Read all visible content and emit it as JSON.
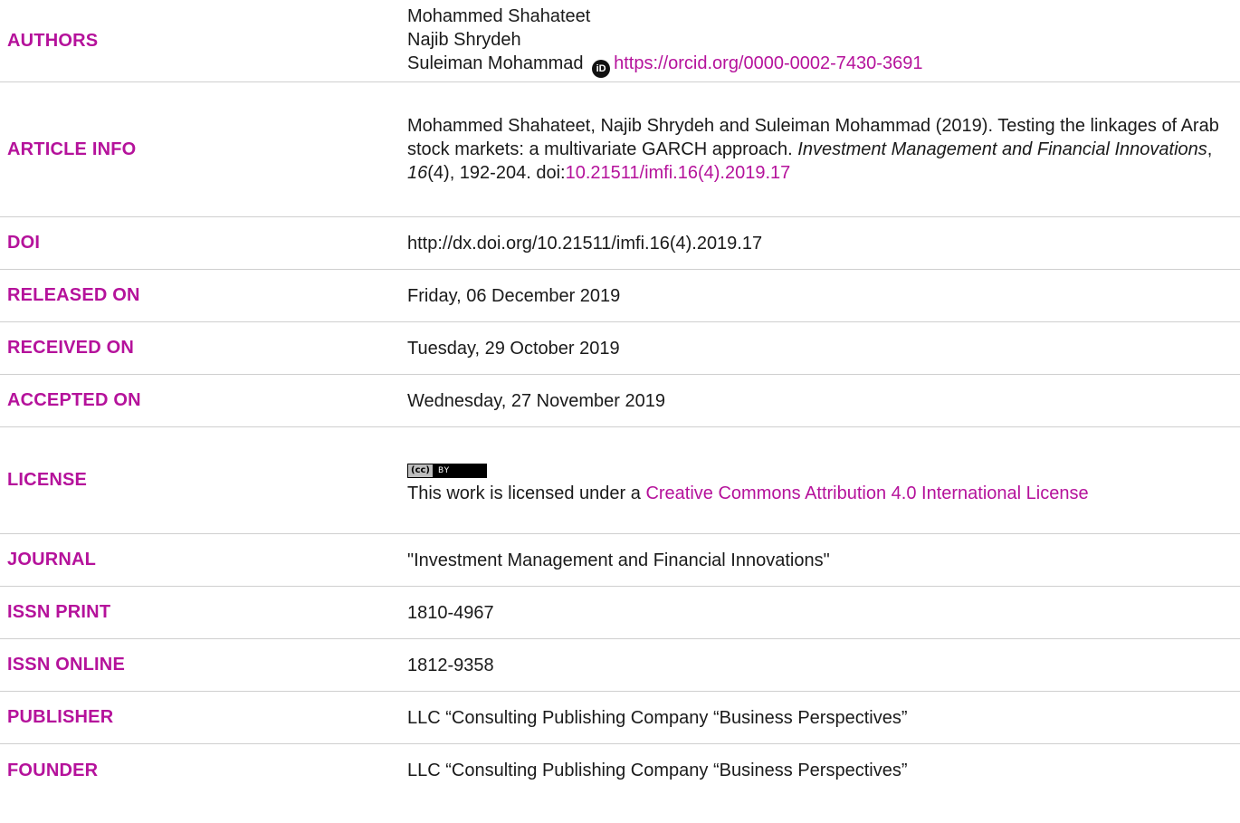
{
  "authors": {
    "label": "AUTHORS",
    "names": [
      "Mohammed Shahateet",
      "Najib Shrydeh",
      "Suleiman Mohammad"
    ],
    "orcid_icon": "orcid-icon",
    "orcid_icon_text": "iD",
    "orcid_url": "https://orcid.org/0000-0002-7430-3691"
  },
  "article_info": {
    "label": "ARTICLE INFO",
    "citation_prefix": "Mohammed Shahateet, Najib Shrydeh and Suleiman Mohammad (2019). Testing the linkages of Arab stock markets: a multivariate GARCH approach. ",
    "journal_italic": "Investment Management and Financial Innovations",
    "comma1": ", ",
    "volume_italic": "16",
    "issue_pages": "(4), 192-204.",
    "doi_prefix": "doi:",
    "doi_link": "10.21511/imfi.16(4).2019.17"
  },
  "doi": {
    "label": "DOI",
    "value": "http://dx.doi.org/10.21511/imfi.16(4).2019.17"
  },
  "released_on": {
    "label": "RELEASED ON",
    "value": "Friday, 06 December 2019"
  },
  "received_on": {
    "label": "RECEIVED ON",
    "value": "Tuesday, 29 October 2019"
  },
  "accepted_on": {
    "label": "ACCEPTED ON",
    "value": "Wednesday, 27 November 2019"
  },
  "license": {
    "label": "LICENSE",
    "badge_left": "(cc)",
    "badge_right": "BY",
    "text_prefix": "This work is licensed under a ",
    "link_text": "Creative Commons Attribution 4.0 International License"
  },
  "journal": {
    "label": "JOURNAL",
    "value": "\"Investment Management and Financial Innovations\""
  },
  "issn_print": {
    "label": "ISSN PRINT",
    "value": "1810-4967"
  },
  "issn_online": {
    "label": "ISSN ONLINE",
    "value": "1812-9358"
  },
  "publisher": {
    "label": "PUBLISHER",
    "value": "LLC “Consulting Publishing Company “Business Perspectives”"
  },
  "founder": {
    "label": "FOUNDER",
    "value": "LLC “Consulting Publishing Company “Business Perspectives”"
  },
  "colors": {
    "label": "#b5129b",
    "link": "#b5129b",
    "divider": "#cfcfcf"
  }
}
